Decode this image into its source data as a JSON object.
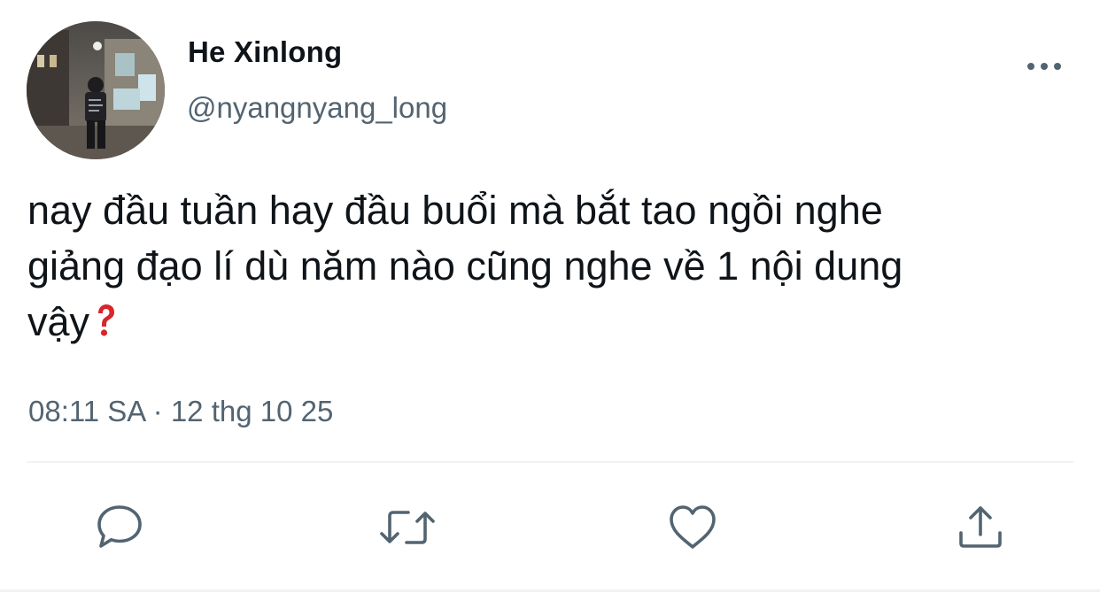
{
  "tweet": {
    "author": {
      "display_name": "He Xinlong",
      "handle": "@nyangnyang_long"
    },
    "text_lines": [
      "nay đầu tuần hay đầu buổi mà bắt tao ngồi nghe",
      "giảng đạo lí dù năm nào cũng nghe về 1 nội dung",
      "vậy"
    ],
    "timestamp": "08:11 SA · 12 thg 10 25",
    "actions": [
      "reply-icon",
      "retweet-icon",
      "like-icon",
      "share-icon"
    ]
  },
  "colors": {
    "text_primary": "#0f1419",
    "text_secondary": "#536471",
    "divider": "#eff3f4",
    "emoji_red": "#d9252b"
  }
}
